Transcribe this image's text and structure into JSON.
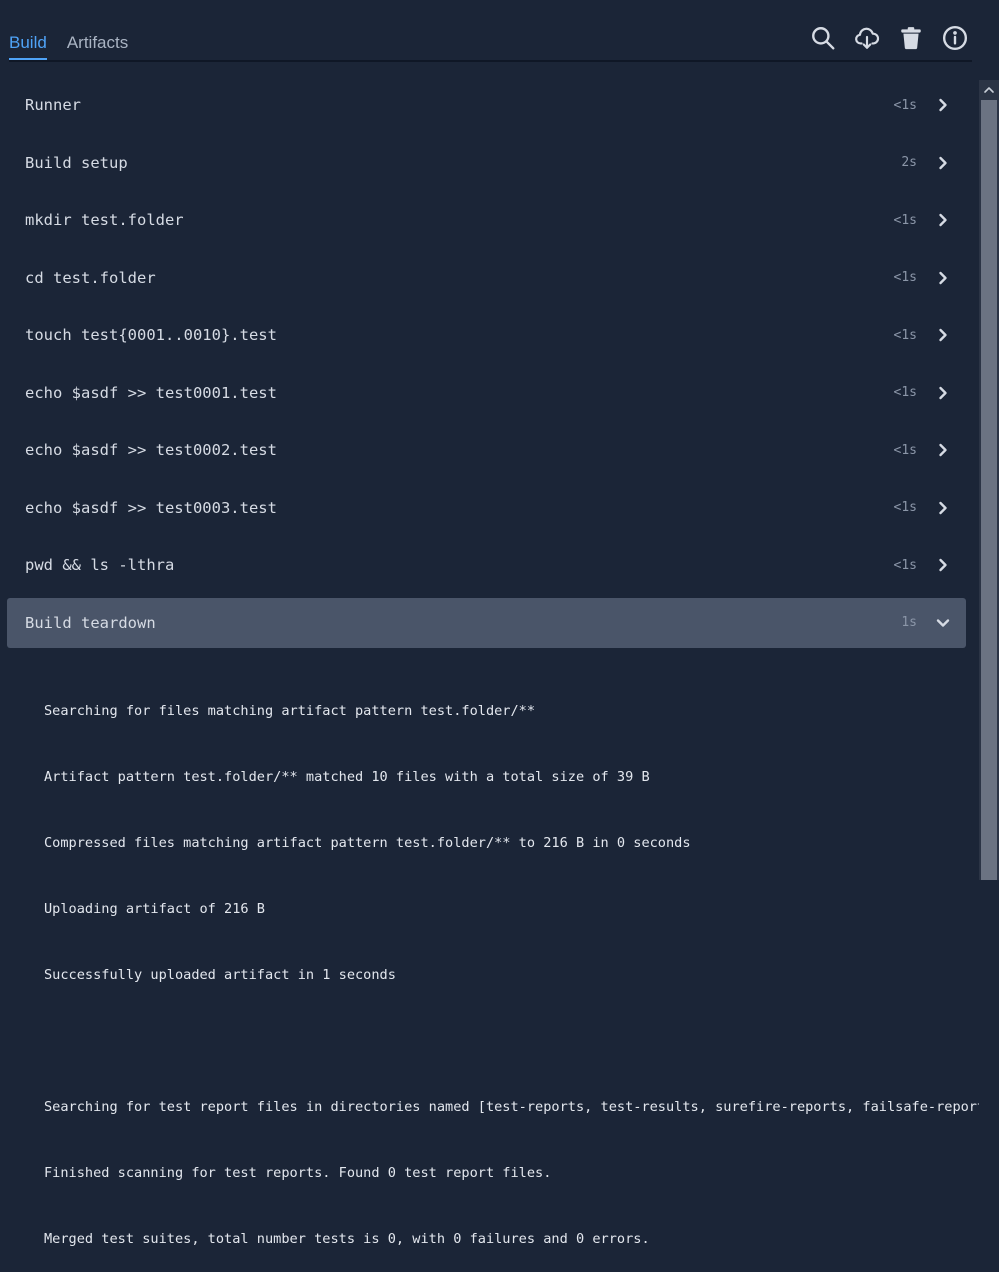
{
  "tabs": [
    {
      "label": "Build",
      "active": true
    },
    {
      "label": "Artifacts",
      "active": false
    }
  ],
  "toolbar_icons": [
    "search-icon",
    "cloud-download-icon",
    "trash-icon",
    "info-icon"
  ],
  "steps": [
    {
      "name": "Runner",
      "duration": "<1s"
    },
    {
      "name": "Build setup",
      "duration": "2s"
    },
    {
      "name": "mkdir test.folder",
      "duration": "<1s"
    },
    {
      "name": "cd test.folder",
      "duration": "<1s"
    },
    {
      "name": "touch test{0001..0010}.test",
      "duration": "<1s"
    },
    {
      "name": "echo $asdf >> test0001.test",
      "duration": "<1s"
    },
    {
      "name": "echo $asdf >> test0002.test",
      "duration": "<1s"
    },
    {
      "name": "echo $asdf >> test0003.test",
      "duration": "<1s"
    },
    {
      "name": "pwd && ls -lthra",
      "duration": "<1s"
    },
    {
      "name": "Build teardown",
      "duration": "1s",
      "expanded": true
    }
  ],
  "log_lines": [
    "Searching for files matching artifact pattern test.folder/**",
    "Artifact pattern test.folder/** matched 10 files with a total size of 39 B",
    "Compressed files matching artifact pattern test.folder/** to 216 B in 0 seconds",
    "Uploading artifact of 216 B",
    "Successfully uploaded artifact in 1 seconds",
    "",
    "Searching for test report files in directories named [test-reports, test-results, surefire-reports, failsafe-reports]",
    "Finished scanning for test reports. Found 0 test report files.",
    "Merged test suites, total number tests is 0, with 0 failures and 0 errors."
  ],
  "colors": {
    "background": "#1b2537",
    "accent": "#4fa3f7",
    "expanded_row": "#4a5569"
  }
}
